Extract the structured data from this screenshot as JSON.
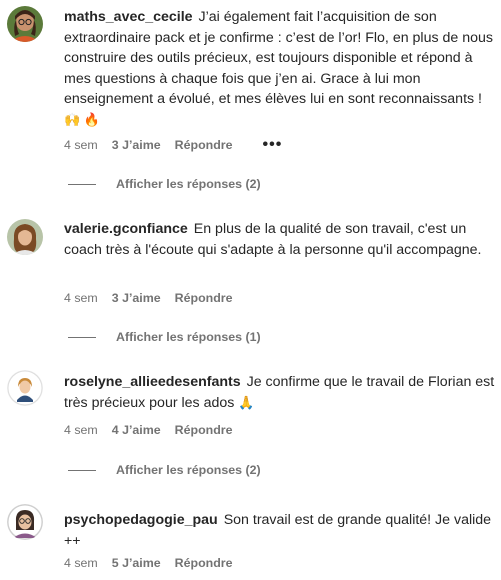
{
  "comments": [
    {
      "username": "maths_avec_cecile",
      "text": "J’ai également fait l’acquisition de son extraordinaire pack et je confirme : c’est de l’or! Flo, en plus de nous construire des outils précieux, est toujours disponible et répond à mes questions à chaque fois que j’en ai. Grace à lui mon enseignement a évolué, et mes élèves lui en sont reconnaissants ! ",
      "emojis": "🙌 🔥",
      "time": "4 sem",
      "likes": "3 J’aime",
      "reply": "Répondre",
      "more": "•••",
      "view_replies": "Afficher les réponses (2)"
    },
    {
      "username": "valerie.gconfiance",
      "text": "En plus de la qualité de son travail, c'est un coach très à l'écoute qui s'adapte à la personne qu'il accompagne.",
      "emojis": "",
      "time": "4 sem",
      "likes": "3 J’aime",
      "reply": "Répondre",
      "view_replies": "Afficher les réponses (1)"
    },
    {
      "username": "roselyne_allieedesenfants",
      "text": "Je confirme que le travail de Florian est très précieux pour les ados ",
      "emojis": "🙏",
      "time": "4 sem",
      "likes": "4 J’aime",
      "reply": "Répondre",
      "view_replies": "Afficher les réponses (2)"
    },
    {
      "username": "psychopedagogie_pau",
      "text": "Son travail est de grande qualité! Je valide ++",
      "emojis": "",
      "time": "4 sem",
      "likes": "5 J’aime",
      "reply": "Répondre"
    }
  ],
  "icons": {
    "avatar_1": "avatar-woman-glasses-icon",
    "avatar_2": "avatar-woman-icon",
    "avatar_3": "avatar-illustration-icon",
    "avatar_4": "avatar-woman-glasses-icon"
  },
  "colors": {
    "text": "#262626",
    "secondary": "#737373",
    "background": "#ffffff"
  }
}
